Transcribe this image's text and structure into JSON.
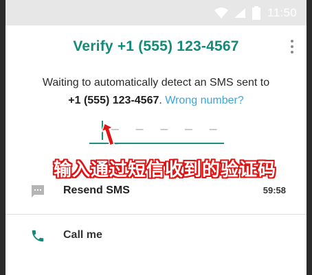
{
  "status_bar": {
    "time": "11:50"
  },
  "header": {
    "title": "Verify +1 (555) 123-4567"
  },
  "description": {
    "line1": "Waiting to automatically detect an SMS sent to",
    "number": "+1 (555) 123-4567",
    "period": ".",
    "wrong_number_link": "Wrong number?"
  },
  "code_input": {
    "placeholder": "– – –   – – –"
  },
  "annotation": {
    "text": "输入通过短信收到的验证码"
  },
  "actions": {
    "resend": {
      "label": "Resend SMS",
      "timer": "59:58"
    },
    "call": {
      "label": "Call me"
    }
  },
  "colors": {
    "accent": "#138b78",
    "link": "#3aa5d8",
    "annotation": "#e01515"
  }
}
